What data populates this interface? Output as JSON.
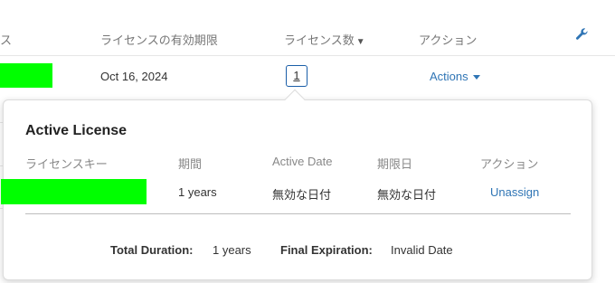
{
  "table": {
    "headers": {
      "col0": "ス",
      "expiry": "ライセンスの有効期限",
      "license_count": "ライセンス数",
      "sort_arrow": "▼",
      "action": "アクション"
    },
    "settings_icon": "wrench-icon",
    "row": {
      "expiry_date": "Oct 16, 2024",
      "license_count": "1",
      "actions_label": "Actions"
    }
  },
  "popover": {
    "title": "Active License",
    "columns": {
      "license_key": "ライセンスキー",
      "period": "期間",
      "active_date": "Active Date",
      "expiry_date": "期限日",
      "action": "アクション"
    },
    "row": {
      "period": "1 years",
      "active_date": "無効な日付",
      "expiry_date": "無効な日付",
      "action": "Unassign"
    },
    "summary": {
      "total_duration_label": "Total Duration:",
      "total_duration_value": "1 years",
      "final_expiration_label": "Final Expiration:",
      "final_expiration_value": "Invalid Date"
    }
  },
  "colors": {
    "link": "#2f75b5",
    "badge_border": "#1a5ea8",
    "redaction": "#00ff00"
  }
}
